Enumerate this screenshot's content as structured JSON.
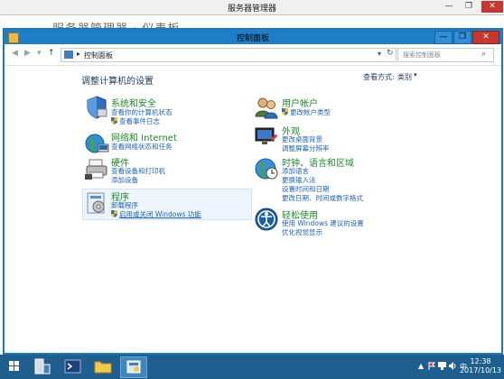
{
  "outer_window": {
    "title": "服务器管理器",
    "peek_text": "服务器管理器 · 仪表板",
    "min": "—",
    "max": "❐",
    "close": "✕"
  },
  "window": {
    "title": "控制面板",
    "min": "—",
    "max": "❐",
    "close": "✕"
  },
  "toolbar": {
    "back": "◀",
    "forward": "▶",
    "dropdown": "▾",
    "up": "↑",
    "breadcrumb_arrow": "▸",
    "address": "控制面板",
    "address_dropdown": "▾",
    "refresh": "↻",
    "search_placeholder": "搜索控制面板",
    "search_icon": "⌕"
  },
  "page": {
    "heading": "调整计算机的设置",
    "view_by_label": "查看方式:",
    "view_by_value": "类别",
    "view_by_dropdown": "▾"
  },
  "categories": {
    "system_security": {
      "title": "系统和安全",
      "links": [
        "查看你的计算机状态",
        "查看事件日志"
      ]
    },
    "network": {
      "title": "网络和 Internet",
      "links": [
        "查看网络状态和任务"
      ]
    },
    "hardware": {
      "title": "硬件",
      "links": [
        "查看设备和打印机",
        "添加设备"
      ]
    },
    "programs": {
      "title": "程序",
      "links": [
        "卸载程序",
        "启用或关闭 Windows 功能"
      ]
    },
    "user_accounts": {
      "title": "用户帐户",
      "links": [
        "更改帐户类型"
      ]
    },
    "appearance": {
      "title": "外观",
      "links": [
        "更改桌面背景",
        "调整屏幕分辨率"
      ]
    },
    "clock_region": {
      "title": "时钟、语言和区域",
      "links": [
        "添加语言",
        "更换输入法",
        "设置时间和日期",
        "更改日期、时间或数字格式"
      ]
    },
    "ease_of_access": {
      "title": "轻松使用",
      "links": [
        "使用 Windows 建议的设置",
        "优化视觉显示"
      ]
    }
  },
  "taskbar": {
    "time": "12:38",
    "date": "2017/10/13",
    "tray_up": "▲",
    "tray_lang": "中"
  }
}
